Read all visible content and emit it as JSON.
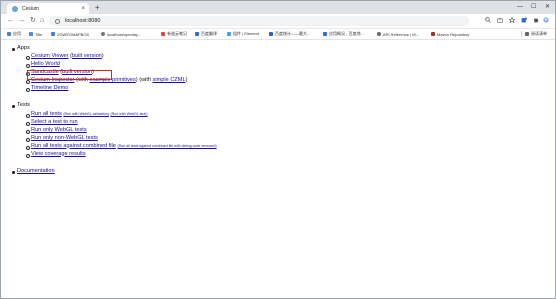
{
  "tab": {
    "title": "Cesium"
  },
  "address": {
    "url": "localhost:8080"
  },
  "bookmarks": [
    {
      "label": "应用",
      "color": "#4a7fd4"
    },
    {
      "label": "Title",
      "color": "#4285f4"
    },
    {
      "label": "ZGWEOMAPBOX",
      "color": "#3d7edb"
    },
    {
      "label": "localhost/openlay...",
      "color": "#777777"
    },
    {
      "label": "有道云笔记",
      "color": "#e8423c"
    },
    {
      "label": "百度翻译",
      "color": "#2d6ad9"
    },
    {
      "label": "组件 | Element",
      "color": "#409eff"
    },
    {
      "label": "百度统计——最大...",
      "color": "#2a63d8"
    },
    {
      "label": "应用概况 - 百度地...",
      "color": "#3568d4"
    },
    {
      "label": "API Reference | M...",
      "color": "#6b6b6b"
    },
    {
      "label": "Maven Repository",
      "color": "#a82c2c"
    },
    {
      "label": "阅读清单",
      "color": "#666666"
    }
  ],
  "page": {
    "apps_heading": "Apps",
    "apps": {
      "cesium_viewer": "Cesium Viewer",
      "cesium_viewer_built": "built version",
      "hello_world": "Hello World",
      "sandcastle": "Sandcastle",
      "sandcastle_built": "built version",
      "inspector": "Cesium Inspector",
      "inspector_with": "(with",
      "inspector_example": "example primitives",
      "inspector_close": ")",
      "inspector_with2": "(with",
      "inspector_czml": "simple CZML",
      "inspector_close2": ")",
      "timeline_demo": "Timeline Demo"
    },
    "tests_heading": "Tests",
    "tests": {
      "run_all": "Run all tests",
      "run_all_webgl_validation": "(Run with WebGL validation)",
      "run_all_webgl_stub": "(Run with WebGL stub)",
      "select_test": "Select a test to run",
      "run_webgl": "Run only WebGL tests",
      "run_non_webgl": "Run only non-WebGL tests",
      "run_combined": "Run all tests against combined file",
      "run_combined_debug": "(Run all tests against combined file with debug code removed)",
      "coverage": "View coverage results"
    },
    "documentation": "Documentation"
  }
}
